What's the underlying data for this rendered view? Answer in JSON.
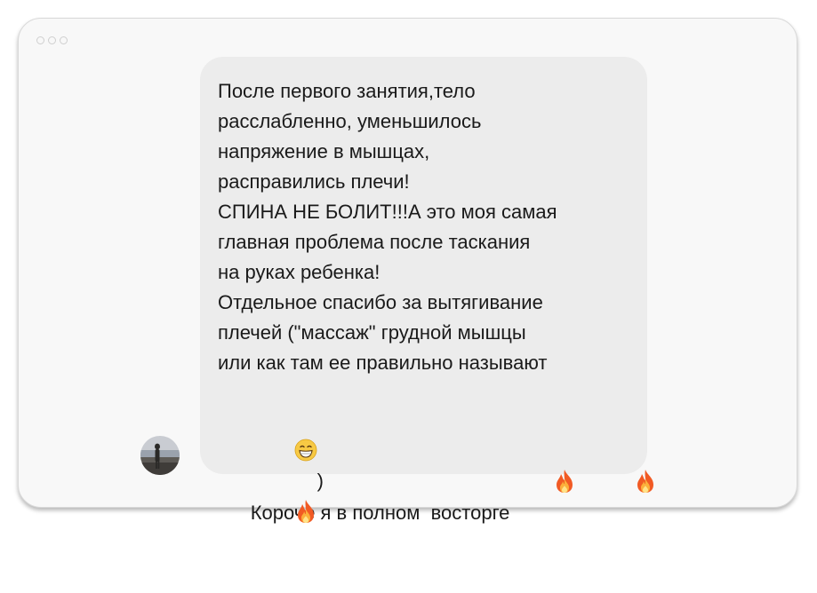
{
  "window": {
    "traffic_lights": [
      "close",
      "minimize",
      "zoom"
    ]
  },
  "message": {
    "sender_avatar": "user-avatar-photo",
    "lines": [
      "После первого занятия,тело",
      "расслабленно, уменьшилось",
      "напряжение в мышцах,",
      "расправились плечи!",
      "СПИНА НЕ БОЛИТ!!!А это моя самая",
      "главная проблема после таскания",
      "на руках ребенка!",
      "Отдельное спасибо за вытягивание",
      "плечей (\"массаж\" грудной мышцы",
      "или как там ее правильно называют"
    ],
    "line_emoji_close": ")",
    "line_last": "Короче я в полном  восторге",
    "emoji": {
      "grin": "grinning-face-emoji",
      "fire": "fire-emoji"
    }
  },
  "colors": {
    "bubble": "#ececec",
    "window": "#f8f8f8",
    "text": "#1a1a1a"
  }
}
